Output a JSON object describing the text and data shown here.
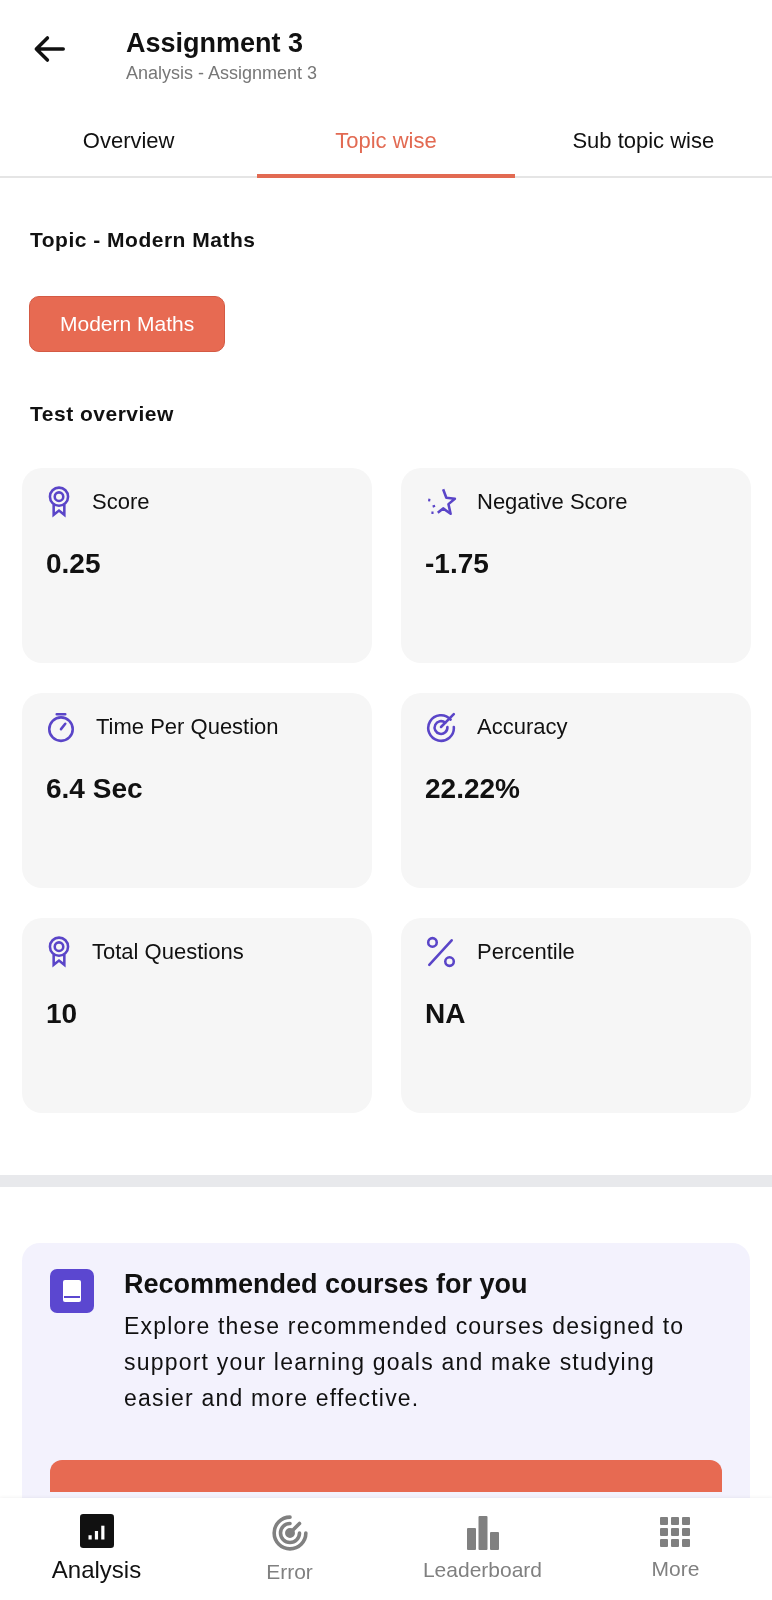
{
  "header": {
    "title": "Assignment 3",
    "subtitle": "Analysis - Assignment 3"
  },
  "tabs": [
    {
      "label": "Overview",
      "selected": false
    },
    {
      "label": "Topic wise",
      "selected": true
    },
    {
      "label": "Sub topic wise",
      "selected": false
    }
  ],
  "topic_heading": "Topic - Modern Maths",
  "topic_chips": [
    {
      "label": "Modern Maths",
      "selected": true
    }
  ],
  "overview_heading": "Test overview",
  "stats": [
    {
      "kind": "medal",
      "label": "Score",
      "value": "0.25"
    },
    {
      "kind": "star",
      "label": "Negative Score",
      "value": "-1.75"
    },
    {
      "kind": "timer",
      "label": "Time Per Question",
      "value": "6.4 Sec"
    },
    {
      "kind": "target",
      "label": "Accuracy",
      "value": "22.22%"
    },
    {
      "kind": "medal",
      "label": "Total Questions",
      "value": "10"
    },
    {
      "kind": "percent",
      "label": "Percentile",
      "value": "NA"
    }
  ],
  "recommended": {
    "title": "Recommended courses for you",
    "text": "Explore these recommended courses designed to support your learning goals and make studying easier and more effective."
  },
  "bottom_nav": [
    {
      "kind": "analysis",
      "label": "Analysis",
      "selected": true
    },
    {
      "kind": "error",
      "label": "Error",
      "selected": false
    },
    {
      "kind": "leaderboard",
      "label": "Leaderboard",
      "selected": false
    },
    {
      "kind": "more",
      "label": "More",
      "selected": false
    }
  ]
}
